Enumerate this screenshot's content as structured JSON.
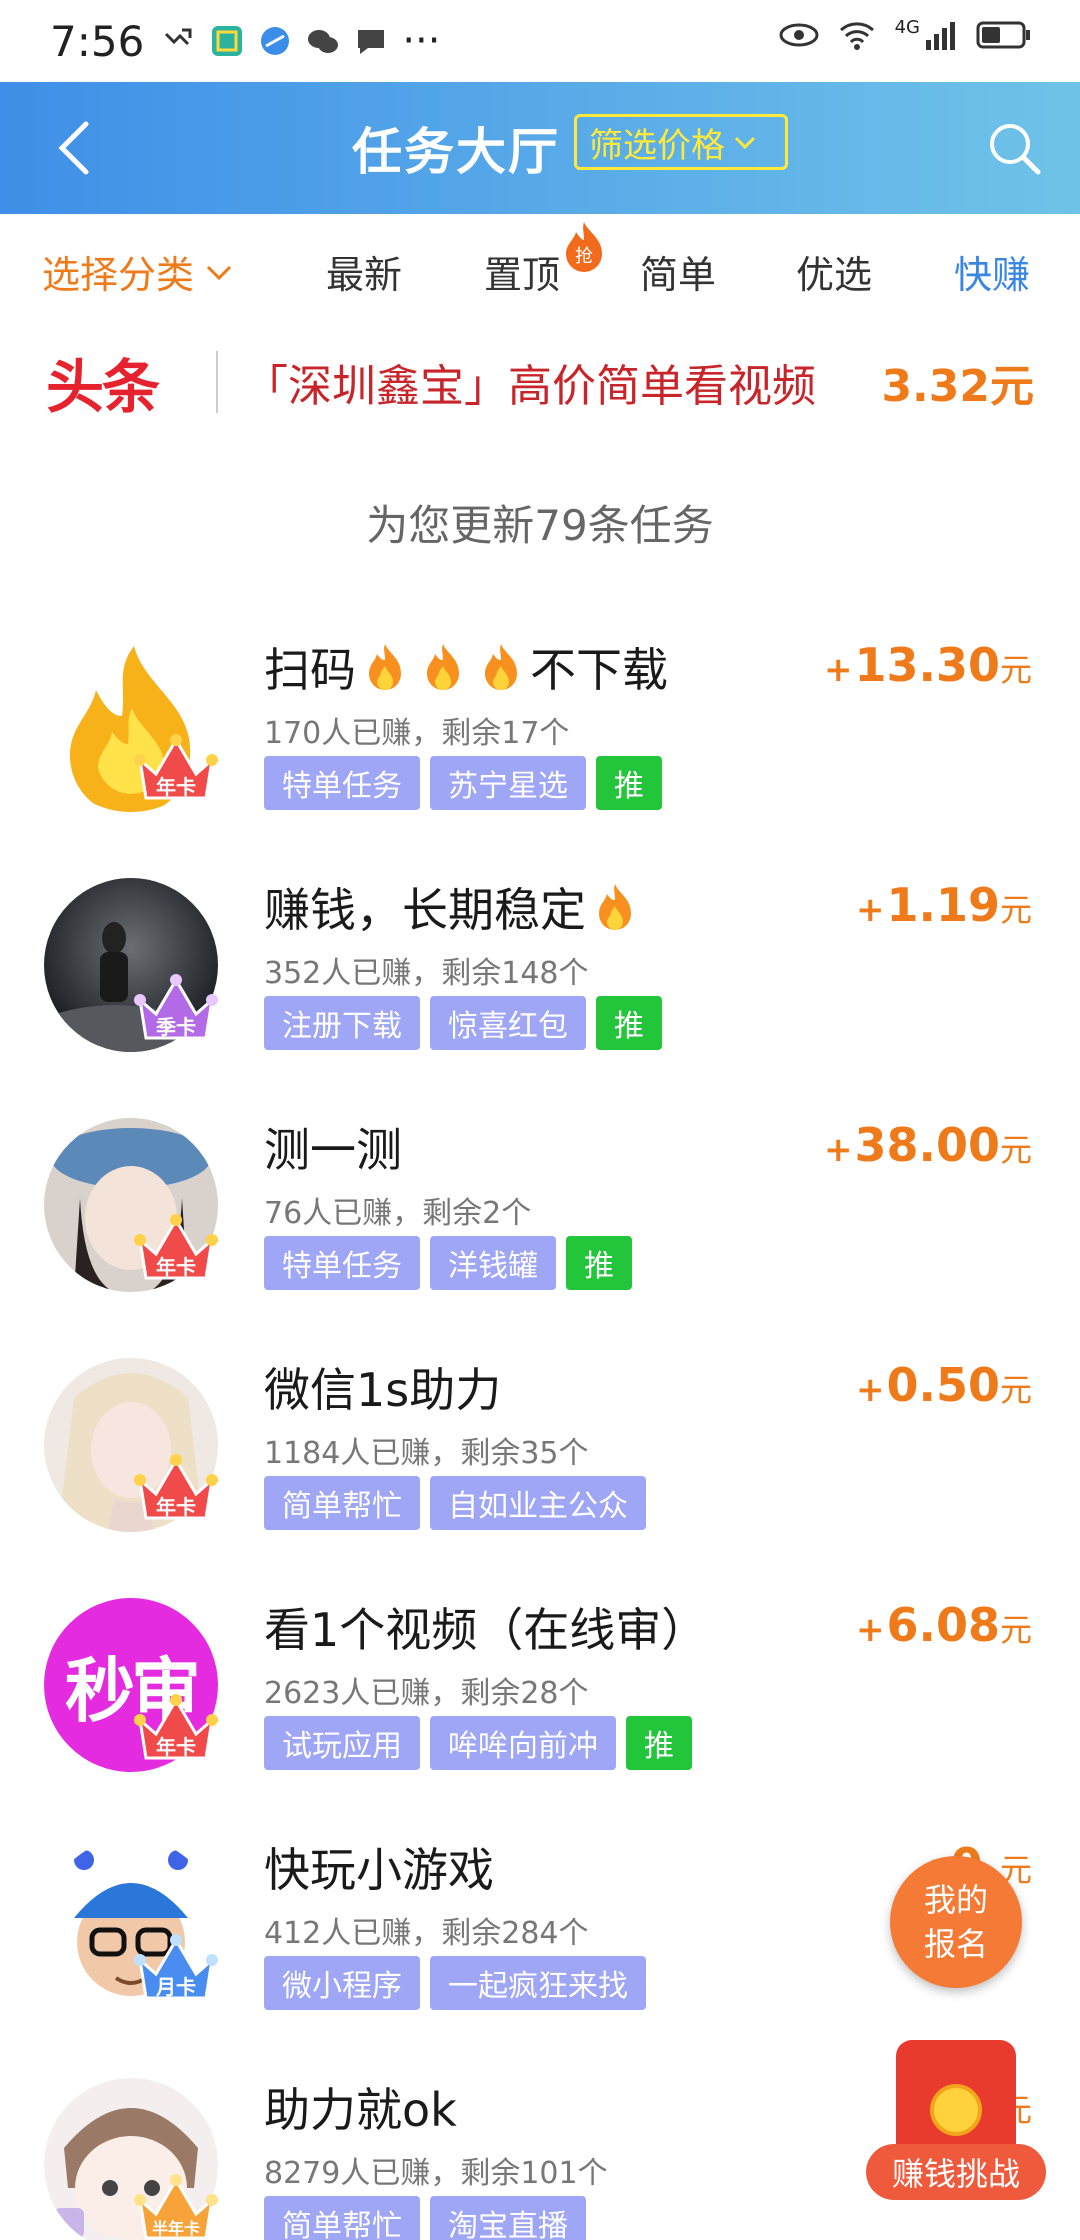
{
  "status_bar": {
    "time": "7:56",
    "dots": "···",
    "network": "4G"
  },
  "header": {
    "title": "任务大厅",
    "filter_label": "筛选价格"
  },
  "tabs": {
    "category": "选择分类",
    "items": [
      "最新",
      "置顶",
      "简单",
      "优选",
      "快赚"
    ],
    "badge": "抢"
  },
  "headline": {
    "logo": "头条",
    "text": "「深圳鑫宝」高价简单看视频",
    "price": "3.32元"
  },
  "update_notice": "为您更新79条任务",
  "tasks": [
    {
      "title": "扫码",
      "title_suffix": "不下载",
      "stats": "170人已赚，剩余17个",
      "tags": [
        "特单任务",
        "苏宁星选",
        "推"
      ],
      "amount": "13.30",
      "badge": "年卡"
    },
    {
      "title": "赚钱，长期稳定",
      "title_suffix": "",
      "stats": "352人已赚，剩余148个",
      "tags": [
        "注册下载",
        "惊喜红包",
        "推"
      ],
      "amount": "1.19",
      "badge": "季卡"
    },
    {
      "title": "测一测",
      "title_suffix": "",
      "stats": "76人已赚，剩余2个",
      "tags": [
        "特单任务",
        "洋钱罐",
        "推"
      ],
      "amount": "38.00",
      "badge": "年卡"
    },
    {
      "title": "微信1s助力",
      "title_suffix": "",
      "stats": "1184人已赚，剩余35个",
      "tags": [
        "简单帮忙",
        "自如业主公众"
      ],
      "amount": "0.50",
      "badge": "年卡"
    },
    {
      "title": "看1个视频（在线审）",
      "title_suffix": "",
      "stats": "2623人已赚，剩余28个",
      "tags": [
        "试玩应用",
        "哞哞向前冲",
        "推"
      ],
      "amount": "6.08",
      "badge": "年卡",
      "avatar_text": "秒审"
    },
    {
      "title": "快玩小游戏",
      "title_suffix": "",
      "stats": "412人已赚，剩余284个",
      "tags": [
        "微小程序",
        "一起疯狂来找"
      ],
      "amount": "0.",
      "badge": "月卡"
    },
    {
      "title": "助力就ok",
      "title_suffix": "",
      "stats": "8279人已赚，剩余101个",
      "tags": [
        "简单帮忙",
        "淘宝直播"
      ],
      "amount": "",
      "badge": "半年卡"
    }
  ],
  "price_prefix": "+",
  "price_unit": "元",
  "fab": {
    "line1": "我的",
    "line2": "报名"
  },
  "red_packet": {
    "label": "赚钱挑战"
  },
  "colors": {
    "accent_orange": "#ef7a1a",
    "header_start": "#3f8fe8",
    "header_end": "#6fc3e8",
    "tag_purple": "#9ea6f5",
    "tag_green": "#23c53a"
  }
}
